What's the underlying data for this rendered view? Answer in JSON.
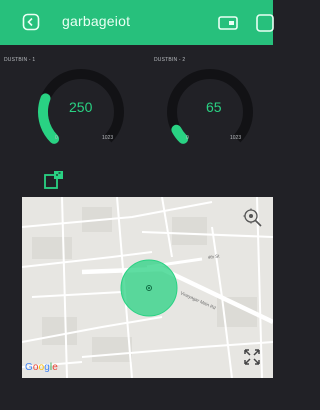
{
  "header": {
    "title": "garbageiot",
    "background": "#27c07c"
  },
  "gauges": [
    {
      "label": "DUSTBIN - 1",
      "value": 250,
      "value_text": "250",
      "min": "0",
      "max": "1023",
      "min_value": 0,
      "max_value": 1023,
      "color": "#29d283"
    },
    {
      "label": "DUSTBIN - 2",
      "value": 65,
      "value_text": "65",
      "min": "0",
      "max": "1023",
      "min_value": 0,
      "max_value": 1023,
      "color": "#29d283"
    }
  ],
  "map": {
    "roads": [
      "4th St",
      "Vinayagar Main Rd"
    ],
    "provider": "Google"
  },
  "icons": [
    "back-icon",
    "device-icon",
    "window-icon",
    "terminal-icon",
    "gps-icon",
    "expand-icon"
  ]
}
